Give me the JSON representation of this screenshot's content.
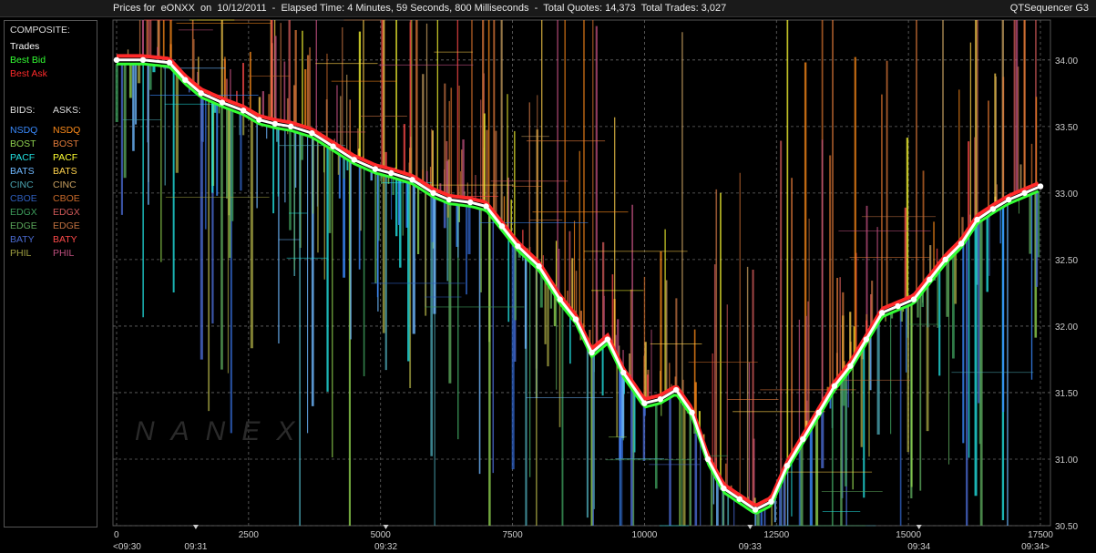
{
  "header": {
    "title": "Prices for  eONXX  on  10/12/2011  -  Elapsed Time: 4 Minutes, 59 Seconds, 800 Milliseconds  -  Total Quotes: 14,373  Total Trades: 3,027",
    "app": "QTSequencer G3"
  },
  "legend": {
    "composite_title": "COMPOSITE:",
    "composite": [
      {
        "label": "Trades",
        "color": "#ffffff"
      },
      {
        "label": "Best Bid",
        "color": "#33ff33"
      },
      {
        "label": "Best Ask",
        "color": "#ff2a2a"
      }
    ],
    "bids_title": "BIDS:",
    "asks_title": "ASKS:",
    "exchanges": [
      {
        "bid": "NSDQ",
        "ask": "NSDQ",
        "bid_color": "#3a8bff",
        "ask_color": "#ff8c1a"
      },
      {
        "bid": "BOST",
        "ask": "BOST",
        "bid_color": "#8fd14f",
        "ask_color": "#e07a3a"
      },
      {
        "bid": "PACF",
        "ask": "PACF",
        "bid_color": "#22e0e0",
        "ask_color": "#ffff33"
      },
      {
        "bid": "BATS",
        "ask": "BATS",
        "bid_color": "#6fb8ff",
        "ask_color": "#ffd24d"
      },
      {
        "bid": "CINC",
        "ask": "CINC",
        "bid_color": "#4aa3b0",
        "ask_color": "#c9a060"
      },
      {
        "bid": "CBOE",
        "ask": "CBOE",
        "bid_color": "#2f5fbf",
        "ask_color": "#c96a2a"
      },
      {
        "bid": "EDGX",
        "ask": "EDGX",
        "bid_color": "#3c9a5a",
        "ask_color": "#d25a5a"
      },
      {
        "bid": "EDGE",
        "ask": "EDGE",
        "bid_color": "#5aa55a",
        "ask_color": "#c07040"
      },
      {
        "bid": "BATY",
        "ask": "BATY",
        "bid_color": "#4a6ad0",
        "ask_color": "#ff4a4a"
      },
      {
        "bid": "PHIL",
        "ask": "PHIL",
        "bid_color": "#a0a040",
        "ask_color": "#c05080"
      }
    ]
  },
  "watermark": "NANEX",
  "chart_data": {
    "type": "line",
    "xlim": [
      0,
      17500
    ],
    "ylim": [
      30.5,
      34.3
    ],
    "x_ticks": [
      {
        "value": 0,
        "label": "0"
      },
      {
        "value": 2500,
        "label": "2500"
      },
      {
        "value": 5000,
        "label": "5000"
      },
      {
        "value": 7500,
        "label": "7500"
      },
      {
        "value": 10000,
        "label": "10000"
      },
      {
        "value": 12500,
        "label": "12500"
      },
      {
        "value": 15000,
        "label": "15000"
      },
      {
        "value": 17500,
        "label": "17500"
      }
    ],
    "time_labels": [
      {
        "value": 0,
        "label": "<09:30"
      },
      {
        "value": 1500,
        "label": "09:31"
      },
      {
        "value": 5100,
        "label": "09:32"
      },
      {
        "value": 12000,
        "label": "09:33"
      },
      {
        "value": 15200,
        "label": "09:34"
      },
      {
        "value": 17500,
        "label": "09:34>"
      }
    ],
    "y_ticks": [
      {
        "value": 30.5,
        "label": "30.50"
      },
      {
        "value": 31.0,
        "label": "31.00"
      },
      {
        "value": 31.5,
        "label": "31.50"
      },
      {
        "value": 32.0,
        "label": "32.00"
      },
      {
        "value": 32.5,
        "label": "32.50"
      },
      {
        "value": 33.0,
        "label": "33.00"
      },
      {
        "value": 33.5,
        "label": "33.50"
      },
      {
        "value": 34.0,
        "label": "34.00"
      }
    ],
    "trades": {
      "x": [
        0,
        500,
        1000,
        1300,
        1600,
        2000,
        2400,
        2700,
        3000,
        3300,
        3700,
        4100,
        4500,
        4900,
        5200,
        5600,
        6000,
        6300,
        6700,
        7000,
        7300,
        7600,
        8000,
        8400,
        8700,
        9000,
        9300,
        9600,
        10000,
        10300,
        10600,
        10900,
        11200,
        11500,
        11800,
        12100,
        12400,
        12700,
        13000,
        13300,
        13600,
        13900,
        14200,
        14500,
        14800,
        15100,
        15400,
        15700,
        16000,
        16300,
        16600,
        16900,
        17200,
        17500
      ],
      "y": [
        34.0,
        34.0,
        33.98,
        33.85,
        33.75,
        33.68,
        33.62,
        33.55,
        33.52,
        33.5,
        33.45,
        33.35,
        33.25,
        33.18,
        33.15,
        33.1,
        33.0,
        32.95,
        32.93,
        32.9,
        32.75,
        32.6,
        32.45,
        32.2,
        32.05,
        31.8,
        31.9,
        31.65,
        31.42,
        31.45,
        31.52,
        31.35,
        31.0,
        30.78,
        30.7,
        30.62,
        30.68,
        30.95,
        31.15,
        31.35,
        31.55,
        31.7,
        31.9,
        32.1,
        32.15,
        32.2,
        32.35,
        32.5,
        32.62,
        32.8,
        32.88,
        32.95,
        33.0,
        33.05
      ]
    }
  }
}
